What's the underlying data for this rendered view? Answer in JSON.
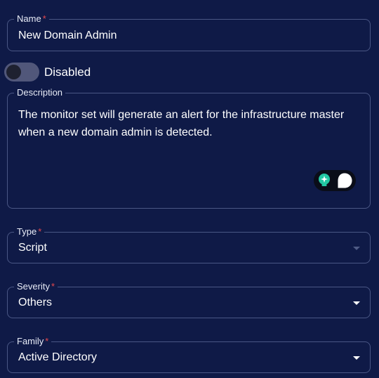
{
  "name_field": {
    "label": "Name",
    "required_mark": "*",
    "value": "New Domain Admin"
  },
  "status_toggle": {
    "label": "Disabled",
    "enabled": false
  },
  "description_field": {
    "label": "Description",
    "value": "The monitor set will generate an alert for the infrastructure master when a new domain admin is detected."
  },
  "ai_assistant": {
    "icons": [
      "lightbulb-sparkle-icon",
      "chat-bubble-icon"
    ]
  },
  "type_field": {
    "label": "Type",
    "required_mark": "*",
    "value": "Script",
    "disabled": true
  },
  "severity_field": {
    "label": "Severity",
    "required_mark": "*",
    "value": "Others"
  },
  "family_field": {
    "label": "Family",
    "required_mark": "*",
    "value": "Active Directory"
  },
  "colors": {
    "background": "#0f1a47",
    "border": "#4a5785",
    "required": "#e5484d",
    "toggle_track": "#51577a",
    "ai_accent": "#23c8a3"
  }
}
